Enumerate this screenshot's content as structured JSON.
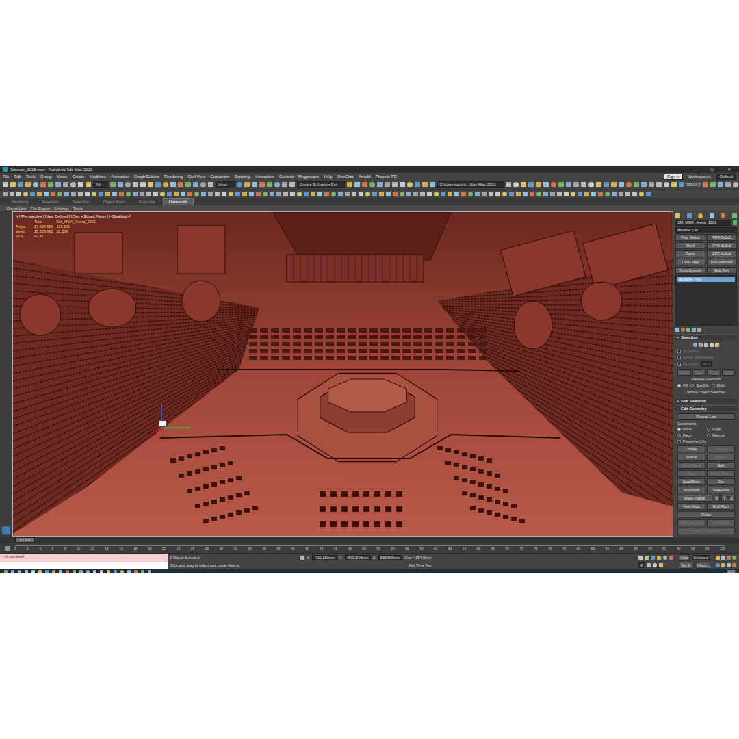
{
  "window": {
    "title": "3dsmax_2018.max - Autodesk 3ds Max 2021",
    "controls": [
      "—",
      "☐",
      "✕"
    ]
  },
  "menu": [
    "File",
    "Edit",
    "Tools",
    "Group",
    "Views",
    "Create",
    "Modifiers",
    "Animation",
    "Graph Editors",
    "Rendering",
    "Civil View",
    "Customize",
    "Scripting",
    "Interactive",
    "Content",
    "Megascans",
    "Help",
    "OneClick",
    "Arnold",
    "Phoenix FD"
  ],
  "account": {
    "sign_in": "Sign In",
    "workspaces_label": "Workspaces:",
    "workspace": "Default"
  },
  "toolbar": {
    "filter": "All",
    "view": "View",
    "selection_set": "Create Selection Set",
    "project_path": "C:\\Users\\admi...\\3ds Max 2021",
    "coord_label": "3DMAX"
  },
  "ribbon": {
    "tabs": [
      {
        "label": "Modeling",
        "selected": false
      },
      {
        "label": "Freeform",
        "selected": false
      },
      {
        "label": "Selection",
        "selected": false
      },
      {
        "label": "Object Paint",
        "selected": false
      },
      {
        "label": "Populate",
        "selected": false
      },
      {
        "label": "Datasmith",
        "selected": true
      }
    ],
    "subtabs": [
      "Direct Link",
      "File Export",
      "Settings",
      "Tools"
    ]
  },
  "viewport": {
    "label": "[+] [Perspective ] [User Defined ] [Clay + Edged Faces ] [<Disabled>]",
    "stats": [
      {
        "label": "",
        "values": [
          "Total",
          "SM_MMA_Arena_1001"
        ]
      },
      {
        "label": "Polys:",
        "values": [
          "27,654,626",
          "119,965"
        ]
      },
      {
        "label": "Verts:",
        "values": [
          "15,529,082",
          "31,239"
        ]
      },
      {
        "label": "FPS:",
        "values": [
          "42,47"
        ]
      }
    ]
  },
  "command_panel": {
    "object_name": "SM_MMA_Arena_1001",
    "modifier_list": "Modifier List",
    "modifier_buttons": [
      "Poly Select",
      "FFD 2x2x2",
      "Shell",
      "FFD 3x3x3",
      "Relax",
      "FFD 4x4x4",
      "UVW Map",
      "ProOptimizer",
      "TurboSmooth",
      "Edit Poly"
    ],
    "stack": [
      {
        "label": "Editable Poly",
        "selected": true
      }
    ],
    "selection": {
      "title": "Selection",
      "expanded": true,
      "checkboxes": [
        {
          "label": "By Vertex",
          "checked": false,
          "disabled": true
        },
        {
          "label": "Ignore Backfacing",
          "checked": false,
          "disabled": true
        },
        {
          "label": "By Angle:",
          "checked": false,
          "disabled": true,
          "value": "45.0"
        }
      ],
      "buttons": [
        {
          "label": "Shrink",
          "disabled": true
        },
        {
          "label": "Grow",
          "disabled": true
        },
        {
          "label": "Ring",
          "disabled": true
        },
        {
          "label": "Loop",
          "disabled": true
        }
      ],
      "preview_label": "Preview Selection",
      "preview": [
        {
          "label": "Off",
          "selected": true
        },
        {
          "label": "SubObj",
          "selected": false
        },
        {
          "label": "Multi",
          "selected": false
        }
      ],
      "status": "Whole Object Selected"
    },
    "soft_selection": {
      "title": "Soft Selection",
      "expanded": false
    },
    "edit_geometry": {
      "title": "Edit Geometry",
      "expanded": true,
      "repeat": "Repeat Last",
      "constraints_label": "Constraints",
      "constraints": [
        {
          "label": "None",
          "selected": true
        },
        {
          "label": "Edge",
          "selected": false
        },
        {
          "label": "Face",
          "selected": false
        },
        {
          "label": "Normal",
          "selected": false
        }
      ],
      "preserve_uvs": {
        "label": "Preserve UVs",
        "checked": false
      },
      "rows": [
        [
          {
            "label": "Create",
            "disabled": false
          },
          {
            "label": "Collapse",
            "disabled": true
          }
        ],
        [
          {
            "label": "Attach",
            "disabled": false
          },
          {
            "label": "Detach",
            "disabled": true
          }
        ],
        [
          {
            "label": "Slice Plane",
            "disabled": true
          },
          {
            "label": "Split",
            "disabled": false
          }
        ],
        [
          {
            "label": "Slice",
            "disabled": true
          },
          {
            "label": "Reset Plane",
            "disabled": true
          }
        ],
        [
          {
            "label": "QuickSlice",
            "disabled": false
          },
          {
            "label": "Cut",
            "disabled": false
          }
        ],
        [
          {
            "label": "MSmooth",
            "disabled": false
          },
          {
            "label": "Tessellate",
            "disabled": false
          }
        ],
        [
          {
            "label": "Make Planar",
            "disabled": false
          },
          {
            "label": "X",
            "disabled": false
          },
          {
            "label": "Y",
            "disabled": false
          },
          {
            "label": "Z",
            "disabled": false
          }
        ],
        [
          {
            "label": "View Align",
            "disabled": false
          },
          {
            "label": "Grid Align",
            "disabled": false
          }
        ],
        [
          {
            "label": "Relax",
            "disabled": false
          }
        ],
        [
          {
            "label": "Hide Selected",
            "disabled": true
          },
          {
            "label": "Unhide All",
            "disabled": true
          }
        ],
        [
          {
            "label": "Hide Unselected",
            "disabled": true
          }
        ]
      ]
    }
  },
  "timeline": {
    "frame": "0 / 100",
    "ticks": [
      "0",
      "2",
      "4",
      "6",
      "8",
      "10",
      "12",
      "14",
      "16",
      "18",
      "20",
      "22",
      "24",
      "26",
      "28",
      "30",
      "32",
      "34",
      "36",
      "38",
      "40",
      "42",
      "44",
      "46",
      "48",
      "50",
      "52",
      "54",
      "56",
      "58",
      "60",
      "62",
      "64",
      "66",
      "68",
      "70",
      "72",
      "74",
      "76",
      "78",
      "80",
      "82",
      "84",
      "86",
      "88",
      "90",
      "92",
      "94",
      "96",
      "98",
      "100"
    ]
  },
  "status_bar": {
    "listener": "-- In top-level",
    "message": "1 Object Selected",
    "prompt": "Click and drag to select and move objects",
    "coords": [
      {
        "label": "X:",
        "value": "-711,150mm"
      },
      {
        "label": "Y:",
        "value": "4592,525mm"
      },
      {
        "label": "Z:",
        "value": "558,865mm"
      }
    ],
    "grid": "Grid = 254,0mm",
    "add_time_tag": "Add Time Tag",
    "current_frame": "0",
    "auto": "Auto",
    "key_mode": "Selected",
    "set_key": "Set K.",
    "filters": "Filters..."
  },
  "taskbar": {
    "time": "19:00"
  }
}
